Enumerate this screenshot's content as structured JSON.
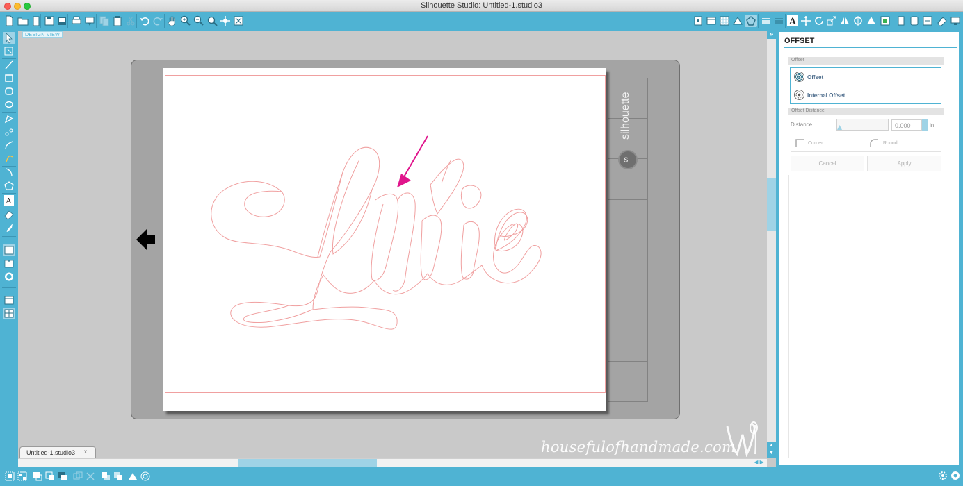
{
  "window": {
    "title": "Silhouette Studio: Untitled-1.studio3"
  },
  "canvas": {
    "view_label": "DESIGN VIEW",
    "mat_brand": "silhouette",
    "artwork_text": "Lilie",
    "document_tab": "Untitled-1.studio3",
    "tab_close": "x"
  },
  "watermark": "housefulofhandmade.com",
  "panel": {
    "title": "OFFSET",
    "offset_section": "Offset",
    "options": [
      {
        "label": "Offset",
        "selected": true
      },
      {
        "label": "Internal Offset",
        "selected": false
      }
    ],
    "distance_section": "Offset Distance",
    "distance_label": "Distance",
    "distance_value": "0.000",
    "distance_unit": "in",
    "corner_label": "Corner",
    "round_label": "Round",
    "cancel_label": "Cancel",
    "apply_label": "Apply"
  },
  "colors": {
    "accent": "#4fb3d3",
    "cut_line": "#f0a0a0",
    "annotation_arrow": "#e0158c"
  }
}
